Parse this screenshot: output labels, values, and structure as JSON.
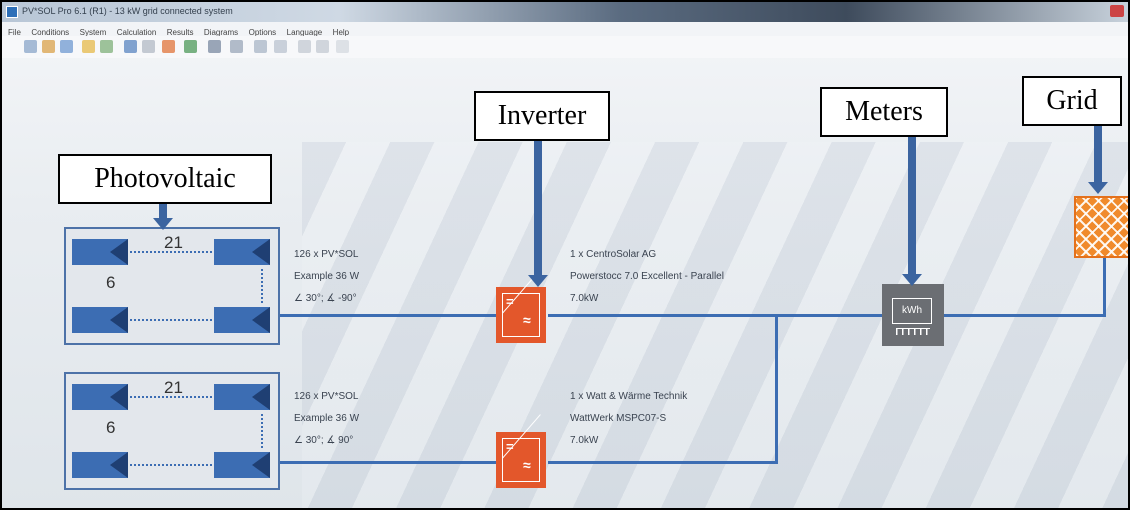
{
  "window": {
    "title": "PV*SOL Pro 6.1 (R1) - 13 kW grid connected system",
    "menu": [
      "File",
      "Conditions",
      "System",
      "Calculation",
      "Results",
      "Diagrams",
      "Options",
      "Language",
      "Help"
    ]
  },
  "callouts": {
    "photovoltaic": "Photovoltaic",
    "inverter": "Inverter",
    "meters": "Meters",
    "grid": "Grid"
  },
  "arrays": [
    {
      "count_top": "21",
      "count_side": "6",
      "modules": "126 x PV*SOL",
      "module_type": "Example 36 W",
      "orientation": "∠ 30°; ∡ -90°"
    },
    {
      "count_top": "21",
      "count_side": "6",
      "modules": "126 x PV*SOL",
      "module_type": "Example 36 W",
      "orientation": "∠ 30°; ∡ 90°"
    }
  ],
  "inverters": [
    {
      "manufacturer": "1 x CentroSolar AG",
      "model": "Powerstocc 7.0 Excellent - Parallel",
      "power": "7.0kW"
    },
    {
      "manufacturer": "1 x Watt & Wärme Technik",
      "model": "WattWerk MSPC07-S",
      "power": "7.0kW"
    }
  ],
  "meter": {
    "label": "kWh"
  },
  "colors": {
    "module": "#3c6db3",
    "inverter": "#e3572b",
    "meter": "#6b6e73",
    "grid": "#f08a2c",
    "arrow": "#3b64a0"
  }
}
